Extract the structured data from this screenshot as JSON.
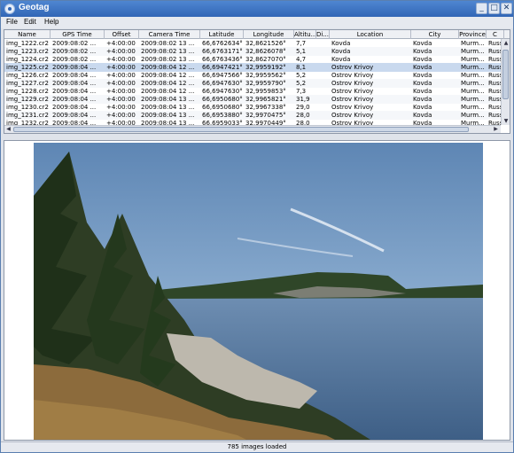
{
  "window": {
    "title": "Geotag"
  },
  "window_buttons": {
    "minimize": "_",
    "maximize": "□",
    "close": "✕"
  },
  "menu": [
    "File",
    "Edit",
    "Help"
  ],
  "table": {
    "columns": [
      "Name",
      "GPS Time",
      "Offset",
      "Camera Time",
      "Latitude",
      "Longitude",
      "Altitu...",
      "Di...",
      "Location",
      "City",
      "Province",
      "C"
    ],
    "rows": [
      [
        "img_1222.cr2",
        "2009:08:02 ...",
        "+4:00:00",
        "2009:08:02 13 ...",
        "66,6762634°",
        "32,8621526°",
        "7,7",
        "",
        "Kovda",
        "Kovda",
        "Murm...",
        "Russia"
      ],
      [
        "img_1223.cr2",
        "2009:08:02 ...",
        "+4:00:00",
        "2009:08:02 13 ...",
        "66,6763171°",
        "32,8626078°",
        "5,1",
        "",
        "Kovda",
        "Kovda",
        "Murm...",
        "Russia"
      ],
      [
        "img_1224.cr2",
        "2009:08:02 ...",
        "+4:00:00",
        "2009:08:02 13 ...",
        "66,6763436°",
        "32,8627070°",
        "4,7",
        "",
        "Kovda",
        "Kovda",
        "Murm...",
        "Russia"
      ],
      [
        "img_1225.cr2",
        "2009:08:04 ...",
        "+4:00:00",
        "2009:08:04 12 ...",
        "66,6947421°",
        "32,9959192°",
        "8,1",
        "",
        "Ostrov Krivoy",
        "Kovda",
        "Murm...",
        "Russia"
      ],
      [
        "img_1226.cr2",
        "2009:08:04 ...",
        "+4:00:00",
        "2009:08:04 12 ...",
        "66,6947566°",
        "32,9959562°",
        "5,2",
        "",
        "Ostrov Krivoy",
        "Kovda",
        "Murm...",
        "Russia"
      ],
      [
        "img_1227.cr2",
        "2009:08:04 ...",
        "+4:00:00",
        "2009:08:04 12 ...",
        "66,6947630°",
        "32,9959790°",
        "5,2",
        "",
        "Ostrov Krivoy",
        "Kovda",
        "Murm...",
        "Russia"
      ],
      [
        "img_1228.cr2",
        "2009:08:04 ...",
        "+4:00:00",
        "2009:08:04 12 ...",
        "66,6947630°",
        "32,9959853°",
        "7,3",
        "",
        "Ostrov Krivoy",
        "Kovda",
        "Murm...",
        "Russia"
      ],
      [
        "img_1229.cr2",
        "2009:08:04 ...",
        "+4:00:00",
        "2009:08:04 13 ...",
        "66,6950680°",
        "32,9965821°",
        "31,9",
        "",
        "Ostrov Krivoy",
        "Kovda",
        "Murm...",
        "Russia"
      ],
      [
        "img_1230.cr2",
        "2009:08:04 ...",
        "+4:00:00",
        "2009:08:04 13 ...",
        "66,6950680°",
        "32,9967338°",
        "29,0",
        "",
        "Ostrov Krivoy",
        "Kovda",
        "Murm...",
        "Russia"
      ],
      [
        "img_1231.cr2",
        "2009:08:04 ...",
        "+4:00:00",
        "2009:08:04 13 ...",
        "66,6953880°",
        "32,9970475°",
        "28,0",
        "",
        "Ostrov Krivoy",
        "Kovda",
        "Murm...",
        "Russia"
      ],
      [
        "img_1232.cr2",
        "2009:08:04 ...",
        "+4:00:00",
        "2009:08:04 13 ...",
        "66,6959033°",
        "32,9970449°",
        "28,0",
        "",
        "Ostrov Krivoy",
        "Kovda",
        "Murm...",
        "Russia"
      ]
    ],
    "selected_row": 3
  },
  "status": {
    "text": "785 images loaded"
  },
  "icons": {
    "app": "geotag-app-icon",
    "scroll_up": "arrow-up-icon",
    "scroll_down": "arrow-down-icon",
    "scroll_left": "arrow-left-icon",
    "scroll_right": "arrow-right-icon"
  },
  "colors": {
    "titlebar": "#3166b6",
    "selection": "#c9d9ee"
  }
}
